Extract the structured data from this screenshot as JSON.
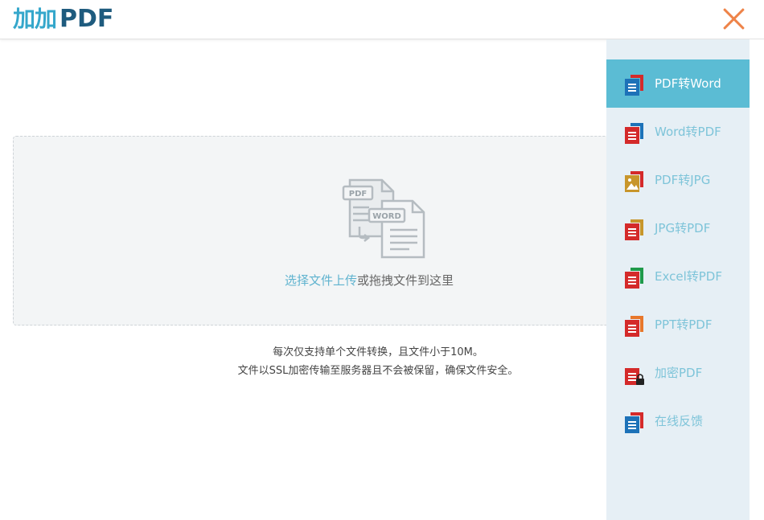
{
  "header": {
    "logo_mark": "加加",
    "logo_text": "PDF"
  },
  "upload": {
    "illustration_tag_pdf": "PDF",
    "illustration_tag_word": "WORD",
    "select_link": "选择文件上传",
    "drag_text": "或拖拽文件到这里"
  },
  "notes": {
    "line1": "每次仅支持单个文件转换，且文件小于10M。",
    "line2": "文件以SSL加密传输至服务器且不会被保留，确保文件安全。"
  },
  "sidebar": {
    "items": [
      {
        "label": "PDF转Word",
        "icon": "word-doc-icon",
        "back": "#d42a2a",
        "front": "#1d72b8",
        "active": true
      },
      {
        "label": "Word转PDF",
        "icon": "pdf-doc-icon",
        "back": "#1d72b8",
        "front": "#d42a2a",
        "active": false
      },
      {
        "label": "PDF转JPG",
        "icon": "image-doc-icon",
        "back": "#d42a2a",
        "front": "#c8962b",
        "active": false
      },
      {
        "label": "JPG转PDF",
        "icon": "pdf-doc-icon",
        "back": "#c8962b",
        "front": "#d42a2a",
        "active": false
      },
      {
        "label": "Excel转PDF",
        "icon": "pdf-doc-icon",
        "back": "#1f9a4a",
        "front": "#d42a2a",
        "active": false
      },
      {
        "label": "PPT转PDF",
        "icon": "pdf-doc-icon",
        "back": "#e8772b",
        "front": "#d42a2a",
        "active": false
      },
      {
        "label": "加密PDF",
        "icon": "lock-doc-icon",
        "back": "",
        "front": "#d42a2a",
        "active": false
      },
      {
        "label": "在线反馈",
        "icon": "feedback-doc-icon",
        "back": "#d42a2a",
        "front": "#1d72b8",
        "active": false
      }
    ]
  }
}
